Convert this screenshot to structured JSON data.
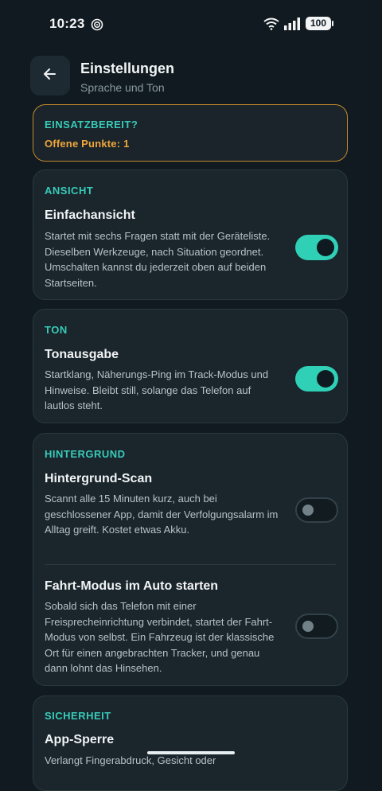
{
  "status_bar": {
    "time": "10:23",
    "battery": "100"
  },
  "header": {
    "title": "Einstellungen",
    "subtitle": "Sprache und Ton"
  },
  "readiness": {
    "label": "EINSATZBEREIT?",
    "open_points": "Offene Punkte: 1"
  },
  "sections": {
    "ansicht": {
      "label": "ANSICHT",
      "title": "Einfachansicht",
      "description": "Startet mit sechs Fragen statt mit der Geräteliste. Dieselben Werkzeuge, nach Situation geordnet. Umschalten kannst du jederzeit oben auf beiden Startseiten.",
      "enabled": true
    },
    "ton": {
      "label": "TON",
      "title": "Tonausgabe",
      "description": "Startklang, Näherungs-Ping im Track-Modus und Hinweise. Bleibt still, solange das Telefon auf lautlos steht.",
      "enabled": true
    },
    "hintergrund": {
      "label": "HINTERGRUND",
      "scan_title": "Hintergrund-Scan",
      "scan_description": "Scannt alle 15 Minuten kurz, auch bei geschlossener App, damit der Verfolgungsalarm im Alltag greift. Kostet etwas Akku.",
      "scan_enabled": false,
      "drive_title": "Fahrt-Modus im Auto starten",
      "drive_description": "Sobald sich das Telefon mit einer Freisprecheinrichtung verbindet, startet der Fahrt-Modus von selbst. Ein Fahrzeug ist der klassische Ort für einen angebrachten Tracker, und genau dann lohnt das Hinsehen.",
      "drive_enabled": false
    },
    "sicherheit": {
      "label": "SICHERHEIT",
      "title": "App-Sperre",
      "description": "Verlangt Fingerabdruck, Gesicht oder"
    }
  },
  "colors": {
    "accent": "#38cbb9",
    "toggle_on": "#2fd0b6",
    "warning": "#f0a63a",
    "background": "#111a20"
  },
  "icons": {
    "back": "arrow-left-icon",
    "wifi": "wifi-icon",
    "signal": "cell-signal-icon",
    "notification": "target-icon"
  }
}
